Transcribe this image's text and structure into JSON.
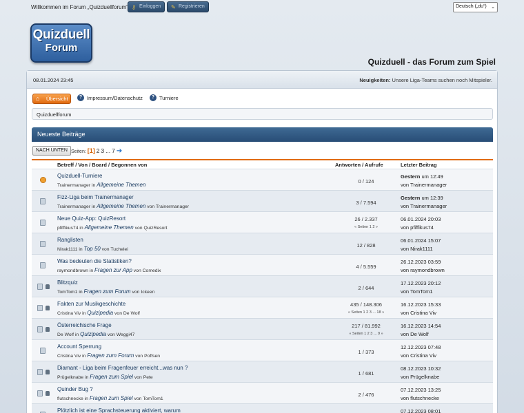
{
  "topbar": {
    "welcome": "Willkommen im Forum „Quizduellforum“.",
    "login_label": "Einloggen",
    "register_label": "Registrieren",
    "language": "Deutsch („du“)"
  },
  "logo": {
    "line1": "Quizduell",
    "line2": "Forum"
  },
  "site_title": "Quizduell - das Forum zum Spiel",
  "upper": {
    "datetime": "08.01.2024 23:45",
    "news_label": "Neuigkeiten:",
    "news_text": "Unsere Liga-Teams suchen noch Mitspieler."
  },
  "menu": {
    "home": "Übersicht",
    "impressum": "Impressum/Datenschutz",
    "turniere": "Turniere"
  },
  "breadcrumb": "Quizduellforum",
  "section_title": "Neueste Beiträge",
  "pagination": {
    "down_button": "NACH UNTEN",
    "label": "Seiten:",
    "current": "[1]",
    "p2": "2",
    "p3": "3",
    "ellipsis": "...",
    "p7": "7"
  },
  "table_header": {
    "col_topic": "Betreff / Von / Board / Begonnen von",
    "col_stats": "Antworten / Aufrufe",
    "col_last": "Letzter Beitrag"
  },
  "rows": [
    {
      "title": "Quizduell-Turniere",
      "by": "Trainermanager",
      "in": "in",
      "board": "Allgemeine Themen",
      "von": "",
      "starter": "",
      "stats": "0 / 124",
      "pages": "",
      "last_date": "Gestern",
      "last_time": "um 12:49",
      "last_by": "von Trainermanager"
    },
    {
      "title": "Fizz-Liga beim Trainermanager",
      "by": "Trainermanager",
      "in": "in",
      "board": "Allgemeine Themen",
      "von": "von",
      "starter": "Trainermanager",
      "stats": "3 / 7.594",
      "pages": "",
      "last_date": "Gestern",
      "last_time": "um 12:39",
      "last_by": "von Trainermanager"
    },
    {
      "title": "Neue Quiz-App: QuizResort",
      "by": "pfiffikus74",
      "in": "in",
      "board": "Allgemeine Themen",
      "von": "von",
      "starter": "QuizResort",
      "stats": "26 / 2.337",
      "pages": "« Seiten 1 2 »",
      "last_date": "06.01.2024 20:03",
      "last_time": "",
      "last_by": "von pfiffikus74"
    },
    {
      "title": "Ranglisten",
      "by": "Nirak1111",
      "in": "in",
      "board": "Top 50",
      "von": "von",
      "starter": "Tuchelei",
      "stats": "12 / 828",
      "pages": "",
      "last_date": "06.01.2024 15:07",
      "last_time": "",
      "last_by": "von Nirak1111"
    },
    {
      "title": "Was bedeuten die Statistiken?",
      "by": "raymondbrown",
      "in": "in",
      "board": "Fragen zur App",
      "von": "von",
      "starter": "Comedix",
      "stats": "4 / 5.559",
      "pages": "",
      "last_date": "26.12.2023 03:59",
      "last_time": "",
      "last_by": "von raymondbrown"
    },
    {
      "title": "Blitzquiz",
      "by": "TomTom1",
      "in": "in",
      "board": "Fragen zum Forum",
      "von": "von",
      "starter": "Ickeen",
      "stats": "2 / 644",
      "pages": "",
      "last_date": "17.12.2023 20:12",
      "last_time": "",
      "last_by": "von TomTom1"
    },
    {
      "title": "Fakten zur Musikgeschichte",
      "by": "Cristina Viv",
      "in": "in",
      "board": "Quizipedia",
      "von": "von",
      "starter": "De Wolf",
      "stats": "435 / 148.306",
      "pages": "« Seiten 1 2 3 ... 18 »",
      "last_date": "16.12.2023 15:33",
      "last_time": "",
      "last_by": "von Cristina Viv"
    },
    {
      "title": "Österreichische Frage",
      "by": "De Wolf",
      "in": "in",
      "board": "Quizipedia",
      "von": "von",
      "starter": "Weggi47",
      "stats": "217 / 81.992",
      "pages": "« Seiten 1 2 3 ... 9 »",
      "last_date": "16.12.2023 14:54",
      "last_time": "",
      "last_by": "von De Wolf"
    },
    {
      "title": "Account Sperrung",
      "by": "Cristina Viv",
      "in": "in",
      "board": "Fragen zum Forum",
      "von": "von",
      "starter": "Poffsen",
      "stats": "1 / 373",
      "pages": "",
      "last_date": "12.12.2023 07:48",
      "last_time": "",
      "last_by": "von Cristina Viv"
    },
    {
      "title": "Diamant - Liga beim Fragenfeuer erreicht...was nun ?",
      "by": "Prügelknabe",
      "in": "in",
      "board": "Fragen zum Spiel",
      "von": "von",
      "starter": "Pete",
      "stats": "1 / 681",
      "pages": "",
      "last_date": "08.12.2023 10:32",
      "last_time": "",
      "last_by": "von Prügelknabe"
    },
    {
      "title": "Quinder Bug ?",
      "by": "flutschnecke",
      "in": "in",
      "board": "Fragen zum Spiel",
      "von": "von",
      "starter": "TomTom1",
      "stats": "2 / 476",
      "pages": "",
      "last_date": "07.12.2023 13:25",
      "last_time": "",
      "last_by": "von flutschnecke"
    },
    {
      "title": "Plötzlich ist eine Sprachsteuerung aktiviert, warum",
      "by": "",
      "in": "",
      "board": "",
      "von": "",
      "starter": "",
      "stats": "15 / 11.009",
      "pages": "",
      "last_date": "07.12.2023 08:01",
      "last_time": "",
      "last_by": ""
    }
  ]
}
